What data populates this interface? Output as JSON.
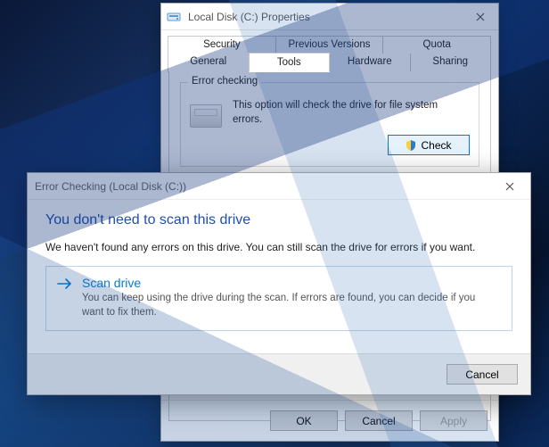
{
  "properties": {
    "title": "Local Disk (C:) Properties",
    "tabs_row1": [
      "Security",
      "Previous Versions",
      "Quota"
    ],
    "tabs_row2": [
      "General",
      "Tools",
      "Hardware",
      "Sharing"
    ],
    "active_tab": "Tools",
    "error_checking": {
      "legend": "Error checking",
      "description": "This option will check the drive for file system errors.",
      "button": "Check"
    },
    "footer": {
      "ok": "OK",
      "cancel": "Cancel",
      "apply": "Apply"
    }
  },
  "dialog": {
    "title": "Error Checking (Local Disk (C:))",
    "headline": "You don't need to scan this drive",
    "message": "We haven't found any errors on this drive. You can still scan the drive for errors if you want.",
    "action": {
      "title": "Scan drive",
      "desc": "You can keep using the drive during the scan. If errors are found, you can decide if you want to fix them."
    },
    "cancel": "Cancel"
  }
}
